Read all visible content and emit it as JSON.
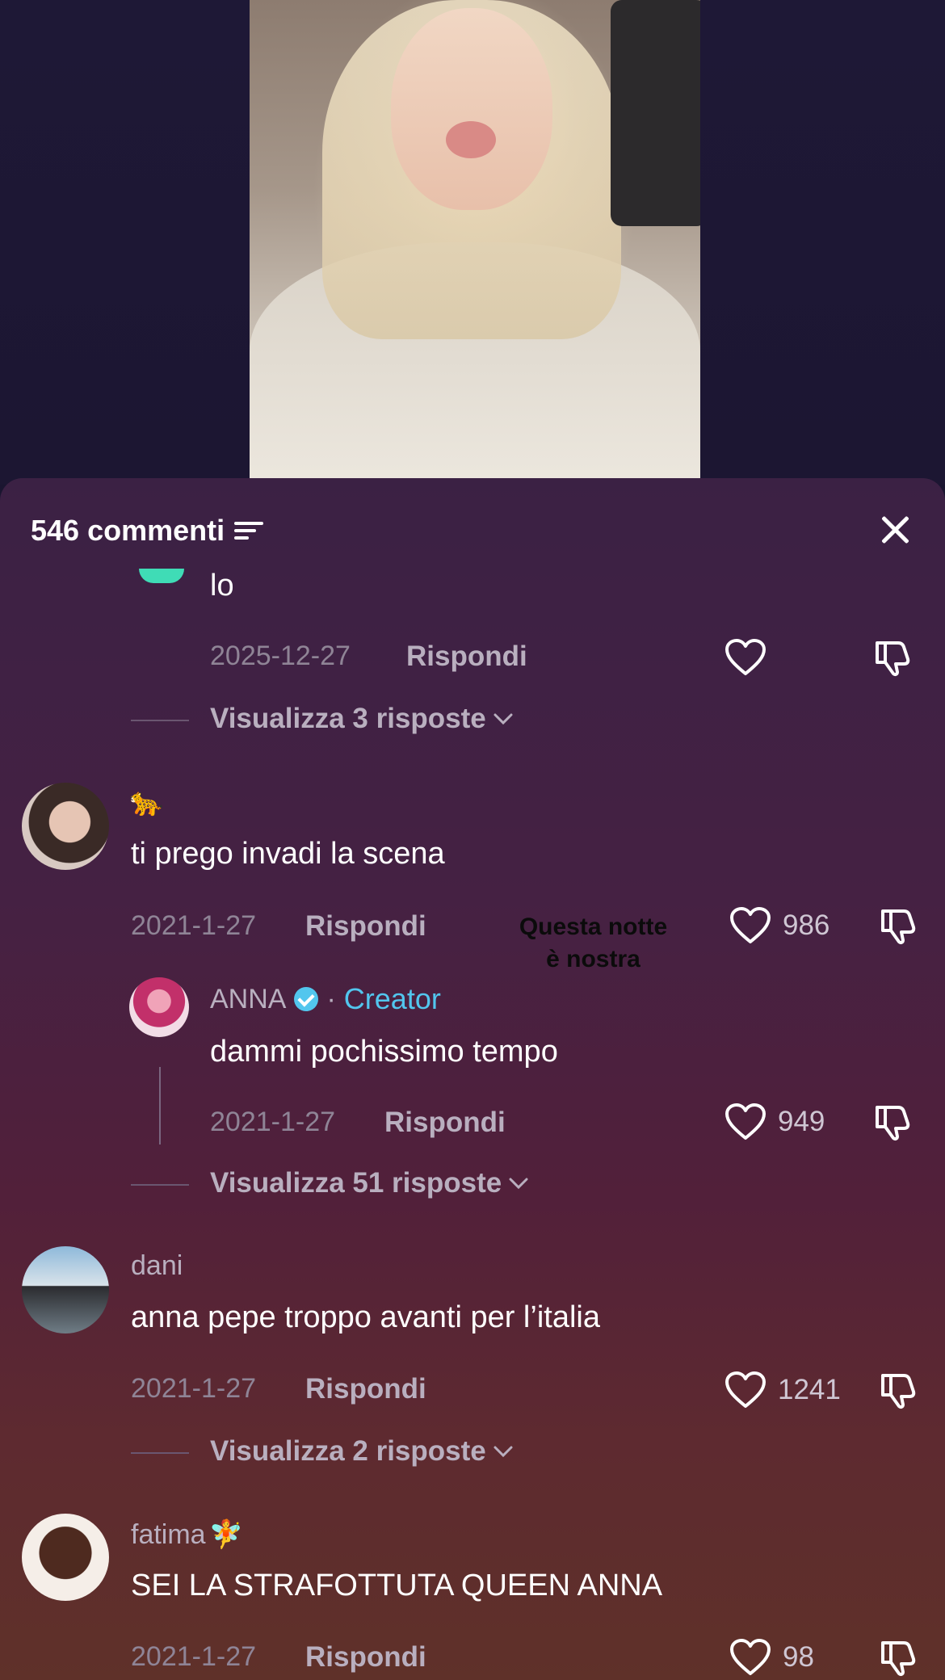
{
  "header": {
    "comments_count": "546 commenti"
  },
  "overlay_sticker": {
    "line1": "Questa notte",
    "line2": "è nostra"
  },
  "partial_comment": {
    "text": "lo",
    "date": "2025-12-27",
    "reply_label": "Rispondi",
    "view_replies": "Visualizza 3 risposte"
  },
  "comments": [
    {
      "username_emoji": "🐆",
      "text": "ti prego invadi la scena",
      "date": "2021-1-27",
      "reply_label": "Rispondi",
      "likes": "986",
      "reply": {
        "username": "ANNA",
        "separator": "·",
        "creator_label": "Creator",
        "text": "dammi pochissimo tempo",
        "date": "2021-1-27",
        "reply_label": "Rispondi",
        "likes": "949"
      },
      "view_replies": "Visualizza 51 risposte"
    },
    {
      "username": "dani",
      "text": "anna pepe troppo avanti per l’italia",
      "date": "2021-1-27",
      "reply_label": "Rispondi",
      "likes": "1241",
      "view_replies": "Visualizza 2 risposte"
    },
    {
      "username": "fatima",
      "username_emoji": "🧚",
      "text": "SEI LA STRAFOTTUTA QUEEN ANNA",
      "date": "2021-1-27",
      "reply_label": "Rispondi",
      "likes": "98"
    }
  ],
  "icons": {
    "close": "close-icon",
    "filter": "filter-icon",
    "like": "heart-icon",
    "dislike": "thumbs-down-icon",
    "expand": "chevron-down-icon",
    "verified": "verified-badge-icon"
  },
  "colors": {
    "creator": "#52c6ee",
    "sheet_top": "#3b2144",
    "sheet_bottom": "#5f3129"
  }
}
